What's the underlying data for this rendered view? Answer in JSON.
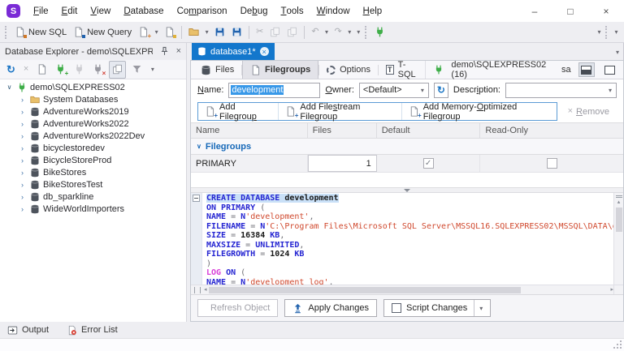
{
  "glyphs": {
    "cut": "✂",
    "undo": "↶",
    "redo": "↷",
    "refresh": "↻",
    "close": "×",
    "drop": "▾",
    "tsql": "T",
    "plus": "+",
    "check": "✓",
    "chev_collapsed": "›",
    "chev_expanded": "∨",
    "group_chev": "∨",
    "up": "▴",
    "left": "◂",
    "right": "▸",
    "minimize": "–",
    "maximize": "□"
  },
  "window": {
    "app_badge": "S",
    "menu": [
      {
        "label": "File",
        "key": 0
      },
      {
        "label": "Edit",
        "key": 0
      },
      {
        "label": "View",
        "key": 0
      },
      {
        "label": "Database",
        "key": 0
      },
      {
        "label": "Comparison",
        "key": 2
      },
      {
        "label": "Debug",
        "key": 2
      },
      {
        "label": "Tools",
        "key": 0
      },
      {
        "label": "Window",
        "key": 0
      },
      {
        "label": "Help",
        "key": 0
      }
    ],
    "controls": [
      {
        "name": "minimize-button",
        "glyph": "minimize"
      },
      {
        "name": "maximize-button",
        "glyph": "maximize"
      },
      {
        "name": "close-button",
        "glyph": "close"
      }
    ]
  },
  "toolbar": {
    "items": [
      {
        "kind": "grip"
      },
      {
        "kind": "btn",
        "name": "new-sql-button",
        "icon": "doc-sql",
        "label": "New SQL"
      },
      {
        "kind": "btn",
        "name": "new-query-button",
        "icon": "doc-query",
        "label": "New Query"
      },
      {
        "kind": "btn",
        "name": "new-document-button",
        "icon": "doc-new"
      },
      {
        "kind": "drop",
        "name": "new-document-dropdown"
      },
      {
        "kind": "btn",
        "name": "new-object-button",
        "icon": "doc-new2"
      },
      {
        "kind": "sep"
      },
      {
        "kind": "btn",
        "name": "open-file-button",
        "icon": "folder"
      },
      {
        "kind": "drop",
        "name": "open-file-dropdown"
      },
      {
        "kind": "btn",
        "name": "save-button",
        "icon": "floppy"
      },
      {
        "kind": "btn",
        "name": "save-all-button",
        "icon": "floppy-all"
      },
      {
        "kind": "sep"
      },
      {
        "kind": "btn",
        "name": "cut-button",
        "icon": "cut",
        "disabled": true
      },
      {
        "kind": "btn",
        "name": "copy-button",
        "icon": "copy",
        "disabled": true
      },
      {
        "kind": "btn",
        "name": "paste-button",
        "icon": "paste",
        "disabled": true
      },
      {
        "kind": "sep"
      },
      {
        "kind": "btn",
        "name": "undo-button",
        "icon": "undo",
        "disabled": true
      },
      {
        "kind": "drop",
        "name": "undo-dropdown"
      },
      {
        "kind": "btn",
        "name": "redo-button",
        "icon": "redo",
        "disabled": true
      },
      {
        "kind": "drop",
        "name": "redo-dropdown"
      },
      {
        "kind": "drop",
        "name": "history-dropdown"
      },
      {
        "kind": "grip"
      },
      {
        "kind": "btn",
        "name": "connect-button",
        "icon": "plug-green"
      }
    ],
    "right": [
      {
        "kind": "drop",
        "name": "toolbar-options-dropdown"
      },
      {
        "kind": "grip"
      },
      {
        "kind": "drop",
        "name": "toolbar-overflow-dropdown"
      }
    ]
  },
  "explorer": {
    "title": "Database Explorer - demo\\SQLEXPRE...",
    "toolbar": [
      {
        "kind": "btn",
        "name": "refresh-button",
        "icon": "refresh"
      },
      {
        "kind": "btn",
        "name": "delete-button",
        "icon": "close",
        "disabled": true
      },
      {
        "kind": "btn",
        "name": "properties-button",
        "icon": "doc-props"
      },
      {
        "kind": "btn",
        "name": "new-connection-button",
        "icon": "plug-add"
      },
      {
        "kind": "btn",
        "name": "connect-database-button",
        "icon": "plug-gray",
        "disabled": true
      },
      {
        "kind": "btn",
        "name": "disconnect-button",
        "icon": "plug-x"
      },
      {
        "kind": "btn",
        "name": "duplicate-object-button",
        "icon": "copy",
        "pressed": true
      },
      {
        "kind": "btn",
        "name": "filter-button",
        "icon": "funnel"
      },
      {
        "kind": "drop",
        "name": "explorer-more-dropdown"
      }
    ],
    "tree": [
      {
        "label": "demo\\SQLEXPRESS02",
        "icon": "server",
        "level": 0,
        "expanded": true
      },
      {
        "label": "System Databases",
        "icon": "folder",
        "level": 1
      },
      {
        "label": "AdventureWorks2019",
        "icon": "database",
        "level": 1
      },
      {
        "label": "AdventureWorks2022",
        "icon": "database",
        "level": 1
      },
      {
        "label": "AdventureWorks2022Dev",
        "icon": "database",
        "level": 1
      },
      {
        "label": "bicyclestoredev",
        "icon": "database",
        "level": 1
      },
      {
        "label": "BicycleStoreProd",
        "icon": "database",
        "level": 1
      },
      {
        "label": "BikeStores",
        "icon": "database",
        "level": 1
      },
      {
        "label": "BikeStoresTest",
        "icon": "database",
        "level": 1
      },
      {
        "label": "db_sparkline",
        "icon": "database",
        "level": 1
      },
      {
        "label": "WideWorldImporters",
        "icon": "database",
        "level": 1
      }
    ]
  },
  "document": {
    "tab_label": "database1*",
    "tabs": [
      {
        "label": "Files",
        "icon": "database"
      },
      {
        "label": "Filegroups",
        "icon": "filegroups",
        "active": true
      },
      {
        "label": "Options",
        "icon": "gear"
      },
      {
        "label": "T-SQL",
        "icon": "tsql"
      }
    ],
    "connection": {
      "server": "demo\\SQLEXPRESS02 (16)",
      "user": "sa"
    }
  },
  "form": {
    "name_label": "Name:",
    "name_key": 0,
    "name_value": "development",
    "owner_label": "Owner:",
    "owner_key": 0,
    "owner_value": "<Default>",
    "description_label": "Description:",
    "description_key": 5,
    "description_value": ""
  },
  "actions": {
    "group": [
      {
        "name": "add-filegroup-button",
        "label": "Add Filegroup",
        "key": 12
      },
      {
        "name": "add-filestream-filegroup-button",
        "label": "Add Filestream Filegroup",
        "key": 8
      },
      {
        "name": "add-memory-optimized-filegroup-button",
        "label": "Add Memory-Optimized Filegroup",
        "key": 11
      }
    ],
    "remove": {
      "label": "Remove",
      "key": 0
    }
  },
  "grid": {
    "columns": [
      "Name",
      "Files",
      "Default",
      "Read-Only"
    ],
    "group_label": "Filegroups",
    "rows": [
      {
        "name": "PRIMARY",
        "files": "1",
        "default": true,
        "read_only": false
      }
    ]
  },
  "sql": {
    "lines": [
      {
        "hl": true,
        "tokens": [
          {
            "t": "CREATE DATABASE ",
            "c": "k"
          },
          {
            "t": "development",
            "c": "i"
          }
        ]
      },
      {
        "tokens": [
          {
            "t": "ON PRIMARY ",
            "c": "k"
          },
          {
            "t": "(",
            "c": "p"
          }
        ]
      },
      {
        "tokens": [
          {
            "t": "NAME",
            "c": "k"
          },
          {
            "t": " = ",
            "c": "p"
          },
          {
            "t": "N",
            "c": "k"
          },
          {
            "t": "'development'",
            "c": "s"
          },
          {
            "t": ",",
            "c": "p"
          }
        ]
      },
      {
        "tokens": [
          {
            "t": "FILENAME",
            "c": "k"
          },
          {
            "t": " = ",
            "c": "p"
          },
          {
            "t": "N",
            "c": "k"
          },
          {
            "t": "'C:\\Program Files\\Microsoft SQL Server\\MSSQL16.SQLEXPRESS02\\MSSQL\\DATA\\developme",
            "c": "s"
          }
        ]
      },
      {
        "tokens": [
          {
            "t": "SIZE",
            "c": "k"
          },
          {
            "t": " = ",
            "c": "p"
          },
          {
            "t": "16384",
            "c": "n"
          },
          {
            "t": " KB",
            "c": "k"
          },
          {
            "t": ",",
            "c": "p"
          }
        ]
      },
      {
        "tokens": [
          {
            "t": "MAXSIZE",
            "c": "k"
          },
          {
            "t": " = ",
            "c": "p"
          },
          {
            "t": "UNLIMITED",
            "c": "k"
          },
          {
            "t": ",",
            "c": "p"
          }
        ]
      },
      {
        "tokens": [
          {
            "t": "FILEGROWTH",
            "c": "k"
          },
          {
            "t": " = ",
            "c": "p"
          },
          {
            "t": "1024",
            "c": "n"
          },
          {
            "t": " KB",
            "c": "k"
          }
        ]
      },
      {
        "tokens": [
          {
            "t": ")",
            "c": "p"
          }
        ]
      },
      {
        "tokens": [
          {
            "t": "LOG",
            "c": "m"
          },
          {
            "t": " ON ",
            "c": "k"
          },
          {
            "t": "(",
            "c": "p"
          }
        ]
      },
      {
        "tokens": [
          {
            "t": "NAME",
            "c": "k"
          },
          {
            "t": " = ",
            "c": "p"
          },
          {
            "t": "N",
            "c": "k"
          },
          {
            "t": "'development_log'",
            "c": "s"
          },
          {
            "t": ",",
            "c": "p"
          }
        ]
      }
    ]
  },
  "footer": {
    "refresh": "Refresh Object",
    "apply": "Apply Changes",
    "script": "Script Changes"
  },
  "bottom": {
    "output": "Output",
    "error_list": "Error List"
  }
}
